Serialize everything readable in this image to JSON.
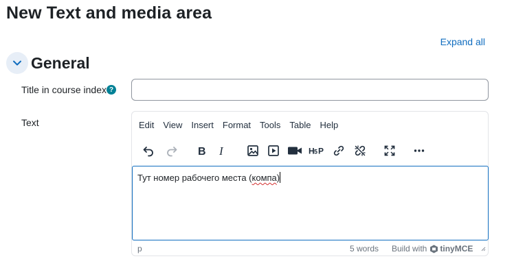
{
  "page": {
    "title": "New Text and media area",
    "expand_all": "Expand all"
  },
  "section": {
    "title": "General"
  },
  "fields": {
    "title_label": "Title in course index",
    "title_value": "",
    "text_label": "Text"
  },
  "editor": {
    "menu": [
      "Edit",
      "View",
      "Insert",
      "Format",
      "Tools",
      "Table",
      "Help"
    ],
    "toolbar_icons": [
      "undo-icon",
      "redo-icon",
      "bold-icon",
      "italic-icon",
      "image-icon",
      "media-icon",
      "video-icon",
      "h5p-icon",
      "link-icon",
      "unlink-icon",
      "fullscreen-icon",
      "more-icon"
    ],
    "content": {
      "prefix": "Тут номер рабочего места (",
      "misspelled": "компа",
      "suffix": ")"
    },
    "status": {
      "path": "p",
      "word_count": "5 words",
      "build_with": "Build with",
      "brand": "tinyMCE"
    }
  },
  "colors": {
    "accent": "#0f6cbf",
    "help": "#008196"
  }
}
